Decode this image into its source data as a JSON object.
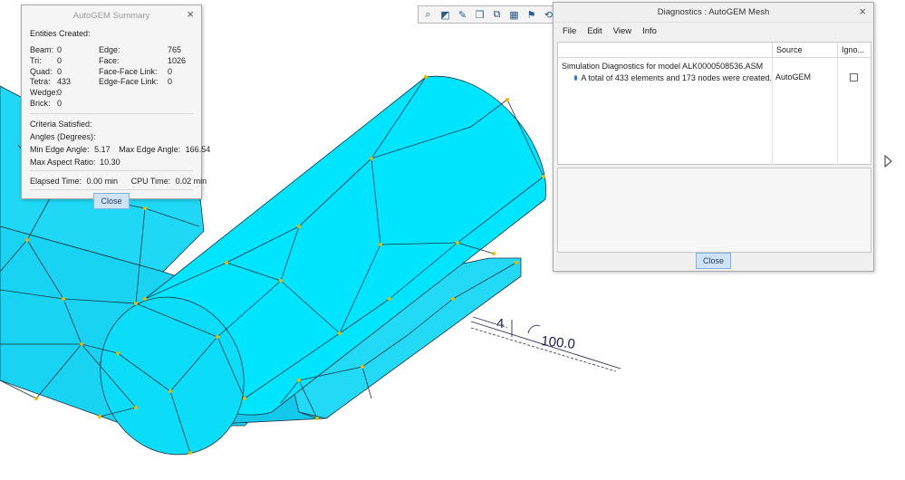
{
  "toolbar": {
    "icons": [
      "zoom-icon",
      "refit-icon",
      "repaint-icon",
      "display-style-icon",
      "saved-orientations-icon",
      "datum-display-icon",
      "annotation-display-icon",
      "spin-center-icon"
    ]
  },
  "summary": {
    "title": "AutoGEM Summary",
    "entities_heading": "Entities Created:",
    "entities": [
      {
        "label": "Beam:",
        "value": "0",
        "label2": "Edge:",
        "value2": "765"
      },
      {
        "label": "Tri:",
        "value": "0",
        "label2": "Face:",
        "value2": "1026"
      },
      {
        "label": "Quad:",
        "value": "0",
        "label2": "Face-Face Link:",
        "value2": "0"
      },
      {
        "label": "Tetra:",
        "value": "433",
        "label2": "Edge-Face Link:",
        "value2": "0"
      },
      {
        "label": "Wedge:",
        "value": "0",
        "label2": "",
        "value2": ""
      },
      {
        "label": "Brick:",
        "value": "0",
        "label2": "",
        "value2": ""
      }
    ],
    "criteria_heading": "Criteria Satisfied:",
    "angles_heading": "Angles (Degrees):",
    "min_edge_label": "Min Edge Angle:",
    "min_edge_value": "5.17",
    "max_edge_label": "Max Edge Angle:",
    "max_edge_value": "166.54",
    "aspect_label": "Max Aspect Ratio:",
    "aspect_value": "10.30",
    "elapsed_label": "Elapsed Time:",
    "elapsed_value": "0.00 min",
    "cpu_label": "CPU Time:",
    "cpu_value": "0.02 min",
    "close_label": "Close"
  },
  "diagnostics": {
    "title": "Diagnostics : AutoGEM Mesh",
    "menu": [
      "File",
      "Edit",
      "View",
      "Info"
    ],
    "columns": [
      "",
      "Source",
      "Igno..."
    ],
    "message_title": "Simulation Diagnostics for model ALK0000508536.ASM",
    "message": "A total of 433 elements and 173 nodes were created.",
    "source": "AutoGEM",
    "ignore_checked": false,
    "close_label": "Close"
  },
  "annotation": {
    "roughness": "4",
    "value": "100.0"
  },
  "colors": {
    "mesh_fill": "#00e5ff",
    "mesh_edge": "#1a3340",
    "node": "#e8b800",
    "accent_button": "#cfe3f5"
  }
}
